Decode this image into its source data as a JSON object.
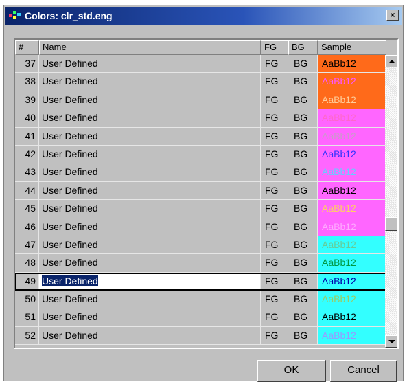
{
  "window": {
    "title": "Colors: clr_std.eng",
    "close_glyph": "×"
  },
  "columns": {
    "num": "#",
    "name": "Name",
    "fg": "FG",
    "bg": "BG",
    "sample": "Sample"
  },
  "rows": [
    {
      "num": "37",
      "name": "User Defined",
      "fg": "FG",
      "bg": "BG",
      "sample": "AaBb12",
      "sample_fg": "#000000",
      "sample_bg": "#ff6a1a"
    },
    {
      "num": "38",
      "name": "User Defined",
      "fg": "FG",
      "bg": "BG",
      "sample": "AaBb12",
      "sample_fg": "#ff55ff",
      "sample_bg": "#ff6a1a"
    },
    {
      "num": "39",
      "name": "User Defined",
      "fg": "FG",
      "bg": "BG",
      "sample": "AaBb12",
      "sample_fg": "#ffcc99",
      "sample_bg": "#ff6a1a"
    },
    {
      "num": "40",
      "name": "User Defined",
      "fg": "FG",
      "bg": "BG",
      "sample": "AaBb12",
      "sample_fg": "#ff66cc",
      "sample_bg": "#ff66ff"
    },
    {
      "num": "41",
      "name": "User Defined",
      "fg": "FG",
      "bg": "BG",
      "sample": "AaBb12",
      "sample_fg": "#cc99cc",
      "sample_bg": "#ff66ff"
    },
    {
      "num": "42",
      "name": "User Defined",
      "fg": "FG",
      "bg": "BG",
      "sample": "AaBb12",
      "sample_fg": "#3333ff",
      "sample_bg": "#ff66ff"
    },
    {
      "num": "43",
      "name": "User Defined",
      "fg": "FG",
      "bg": "BG",
      "sample": "AaBb12",
      "sample_fg": "#66ccff",
      "sample_bg": "#ff66ff"
    },
    {
      "num": "44",
      "name": "User Defined",
      "fg": "FG",
      "bg": "BG",
      "sample": "AaBb12",
      "sample_fg": "#000000",
      "sample_bg": "#ff66ff"
    },
    {
      "num": "45",
      "name": "User Defined",
      "fg": "FG",
      "bg": "BG",
      "sample": "AaBb12",
      "sample_fg": "#ffcc66",
      "sample_bg": "#ff66ff"
    },
    {
      "num": "46",
      "name": "User Defined",
      "fg": "FG",
      "bg": "BG",
      "sample": "AaBb12",
      "sample_fg": "#ffaaff",
      "sample_bg": "#ff66ff"
    },
    {
      "num": "47",
      "name": "User Defined",
      "fg": "FG",
      "bg": "BG",
      "sample": "AaBb12",
      "sample_fg": "#66cc99",
      "sample_bg": "#33ffff"
    },
    {
      "num": "48",
      "name": "User Defined",
      "fg": "FG",
      "bg": "BG",
      "sample": "AaBb12",
      "sample_fg": "#009944",
      "sample_bg": "#33ffff"
    },
    {
      "num": "49",
      "name": "User Defined",
      "fg": "FG",
      "bg": "BG",
      "sample": "AaBb12",
      "sample_fg": "#0000aa",
      "sample_bg": "#33ffff",
      "selected": true
    },
    {
      "num": "50",
      "name": "User Defined",
      "fg": "FG",
      "bg": "BG",
      "sample": "AaBb12",
      "sample_fg": "#99cc66",
      "sample_bg": "#33ffff"
    },
    {
      "num": "51",
      "name": "User Defined",
      "fg": "FG",
      "bg": "BG",
      "sample": "AaBb12",
      "sample_fg": "#000000",
      "sample_bg": "#33ffff"
    },
    {
      "num": "52",
      "name": "User Defined",
      "fg": "FG",
      "bg": "BG",
      "sample": "AaBb12",
      "sample_fg": "#9999ff",
      "sample_bg": "#33ffff"
    }
  ],
  "buttons": {
    "ok": "OK",
    "cancel": "Cancel"
  },
  "icons": {
    "app": "color-palette-icon",
    "close": "close-icon",
    "scroll_up": "arrow-up-icon",
    "scroll_down": "arrow-down-icon"
  },
  "colors": {
    "titlebar": "#0a246a",
    "selection": "#0a246a",
    "face": "#c0c0c0"
  }
}
